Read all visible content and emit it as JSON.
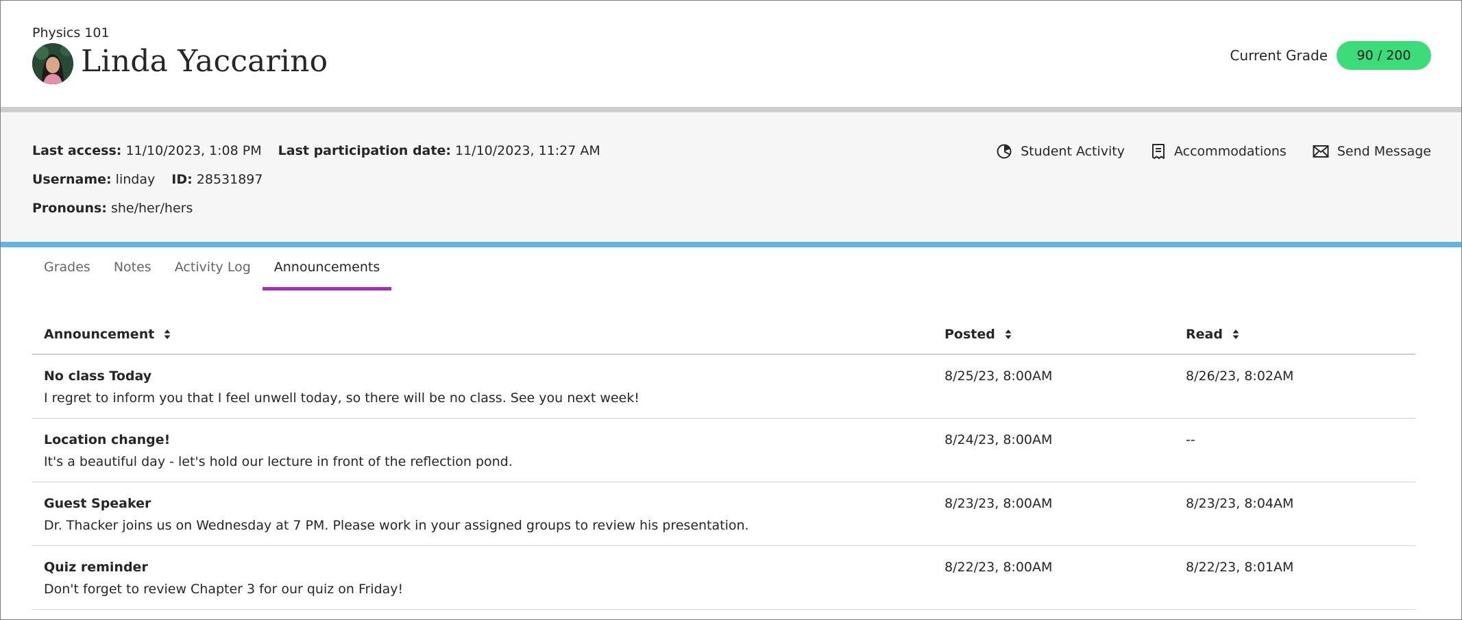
{
  "header": {
    "course": "Physics 101",
    "student_name": "Linda Yaccarino",
    "grade_label": "Current Grade",
    "grade_value": "90 / 200"
  },
  "info": {
    "last_access_label": "Last access:",
    "last_access_value": "11/10/2023, 1:08 PM",
    "last_participation_label": "Last participation date:",
    "last_participation_value": "11/10/2023, 11:27 AM",
    "username_label": "Username:",
    "username_value": "linday",
    "id_label": "ID:",
    "id_value": "28531897",
    "pronouns_label": "Pronouns:",
    "pronouns_value": "she/her/hers"
  },
  "actions": {
    "student_activity": {
      "label": "Student Activity",
      "icon": "pie-chart-icon"
    },
    "accommodations": {
      "label": "Accommodations",
      "icon": "document-icon"
    },
    "send_message": {
      "label": "Send Message",
      "icon": "envelope-icon"
    }
  },
  "tabs": [
    {
      "label": "Grades",
      "active": false
    },
    {
      "label": "Notes",
      "active": false
    },
    {
      "label": "Activity Log",
      "active": false
    },
    {
      "label": "Announcements",
      "active": true
    }
  ],
  "table": {
    "columns": [
      "Announcement",
      "Posted",
      "Read"
    ],
    "rows": [
      {
        "title": "No class Today",
        "body": "I regret to inform you that I feel unwell today, so there will be no class. See you next week!",
        "posted": "8/25/23, 8:00AM",
        "read": "8/26/23, 8:02AM"
      },
      {
        "title": "Location change!",
        "body": "It's a beautiful day - let's hold our lecture in front of the reflection pond.",
        "posted": "8/24/23, 8:00AM",
        "read": "--"
      },
      {
        "title": "Guest Speaker",
        "body": "Dr. Thacker joins us on Wednesday at 7 PM. Please work in your assigned groups to review his presentation.",
        "posted": "8/23/23, 8:00AM",
        "read": "8/23/23, 8:04AM"
      },
      {
        "title": "Quiz reminder",
        "body": "Don't forget to review Chapter 3 for our quiz on Friday!",
        "posted": "8/22/23, 8:00AM",
        "read": "8/22/23, 8:01AM"
      }
    ]
  },
  "colors": {
    "grade_pill": "#3ddc7a",
    "tab_active_underline": "#a330b7",
    "info_band_accent": "#62b4e0",
    "info_band_bg": "#f6f6f6"
  }
}
